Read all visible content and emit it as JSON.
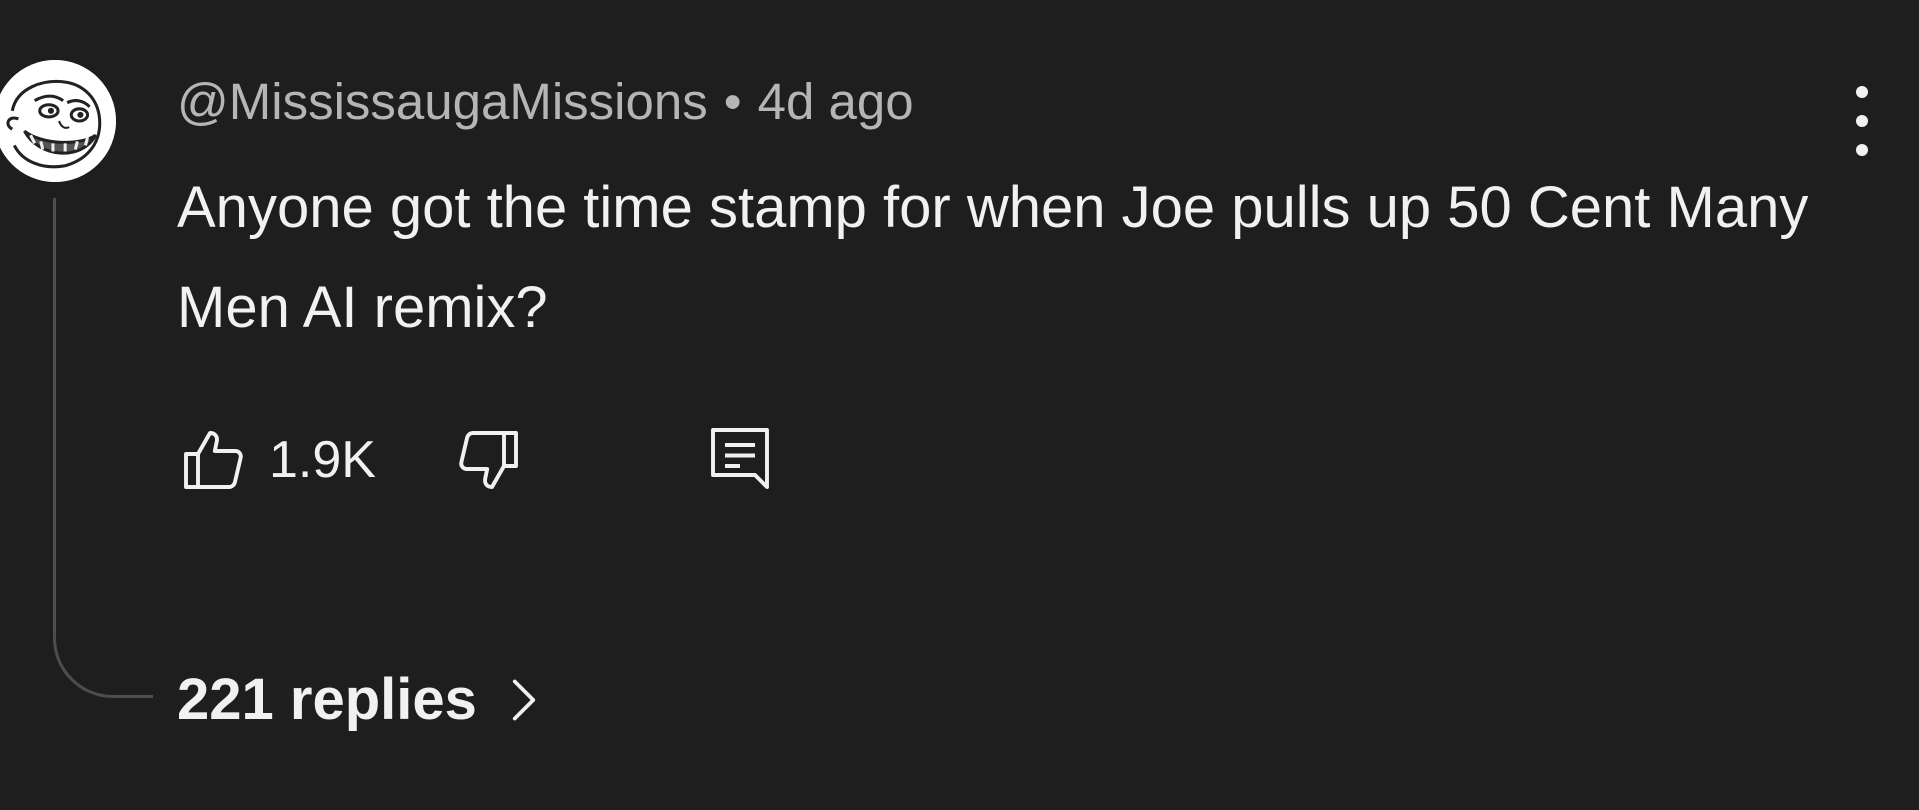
{
  "comment": {
    "author": "@MississaugaMissions",
    "separator": "•",
    "time": "4d ago",
    "text": "Anyone got the time stamp for when Joe pulls up 50 Cent Many Men AI remix?",
    "avatar_icon": "troll-face-avatar",
    "more_icon": "vertical-ellipsis-icon"
  },
  "actions": {
    "like_count": "1.9K",
    "like_icon": "thumbs-up-icon",
    "dislike_icon": "thumbs-down-icon",
    "reply_icon": "comment-reply-icon"
  },
  "replies": {
    "label": "221 replies",
    "icon": "chevron-right-icon"
  },
  "colors": {
    "background": "#1e1e1e",
    "primary_text": "#f1f1f1",
    "secondary_text": "#b5b5b5",
    "thread_line": "#4d4d4d"
  }
}
